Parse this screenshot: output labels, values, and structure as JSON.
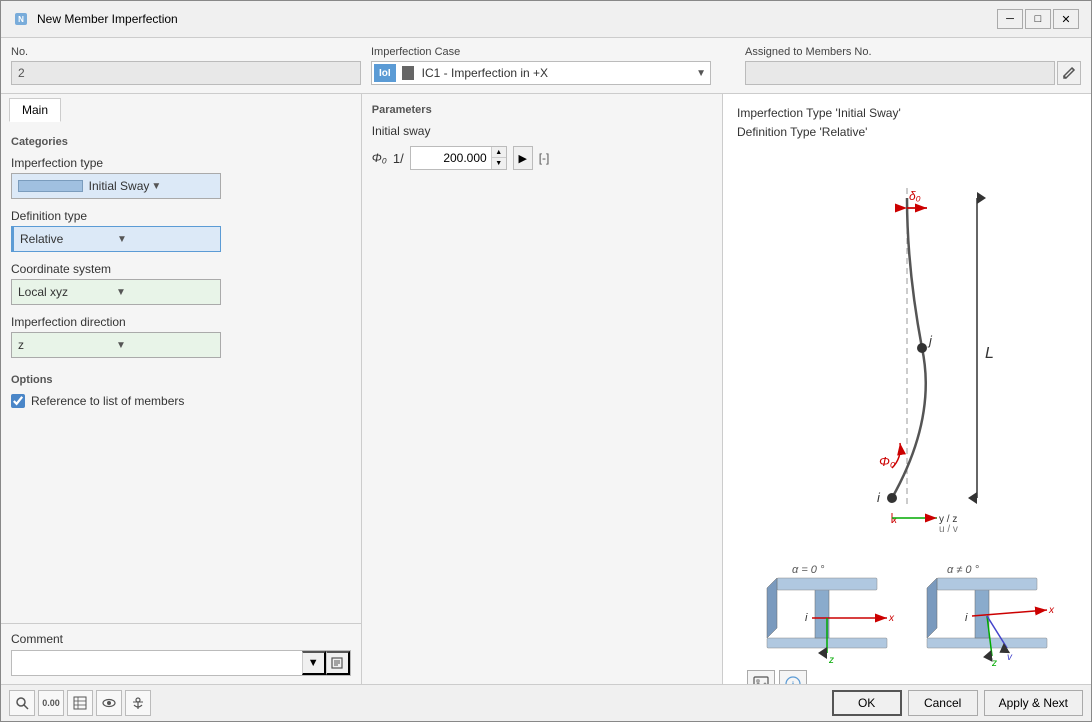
{
  "window": {
    "title": "New Member Imperfection",
    "minimize_label": "─",
    "maximize_label": "□",
    "close_label": "✕"
  },
  "header": {
    "no_label": "No.",
    "no_value": "2",
    "imperfection_case_label": "Imperfection Case",
    "lol_badge": "IoI",
    "case_value": "IC1 - Imperfection in +X",
    "assigned_label": "Assigned to Members No."
  },
  "tabs": {
    "main_label": "Main"
  },
  "categories": {
    "title": "Categories",
    "imperfection_type_label": "Imperfection type",
    "imperfection_type_value": "Initial Sway",
    "definition_type_label": "Definition type",
    "definition_type_value": "Relative",
    "coordinate_system_label": "Coordinate system",
    "coordinate_system_value": "Local xyz",
    "imperfection_direction_label": "Imperfection direction",
    "imperfection_direction_value": "z"
  },
  "options": {
    "title": "Options",
    "reference_label": "Reference to list of members",
    "reference_checked": true
  },
  "comment": {
    "label": "Comment",
    "placeholder": ""
  },
  "parameters": {
    "title": "Parameters",
    "subtitle": "Initial sway",
    "phi_label": "Φ₀",
    "fraction_label": "1/",
    "value": "200.000",
    "unit_label": "[-]"
  },
  "diagram": {
    "title_line1": "Imperfection Type 'Initial Sway'",
    "title_line2": "Definition Type 'Relative'"
  },
  "buttons": {
    "ok_label": "OK",
    "cancel_label": "Cancel",
    "apply_next_label": "Apply & Next"
  },
  "footer_icons": [
    {
      "name": "search-icon",
      "symbol": "🔍"
    },
    {
      "name": "number-icon",
      "symbol": "0.00"
    },
    {
      "name": "table-icon",
      "symbol": "⊞"
    },
    {
      "name": "view-icon",
      "symbol": "👁"
    },
    {
      "name": "anchor-icon",
      "symbol": "⚓"
    }
  ]
}
